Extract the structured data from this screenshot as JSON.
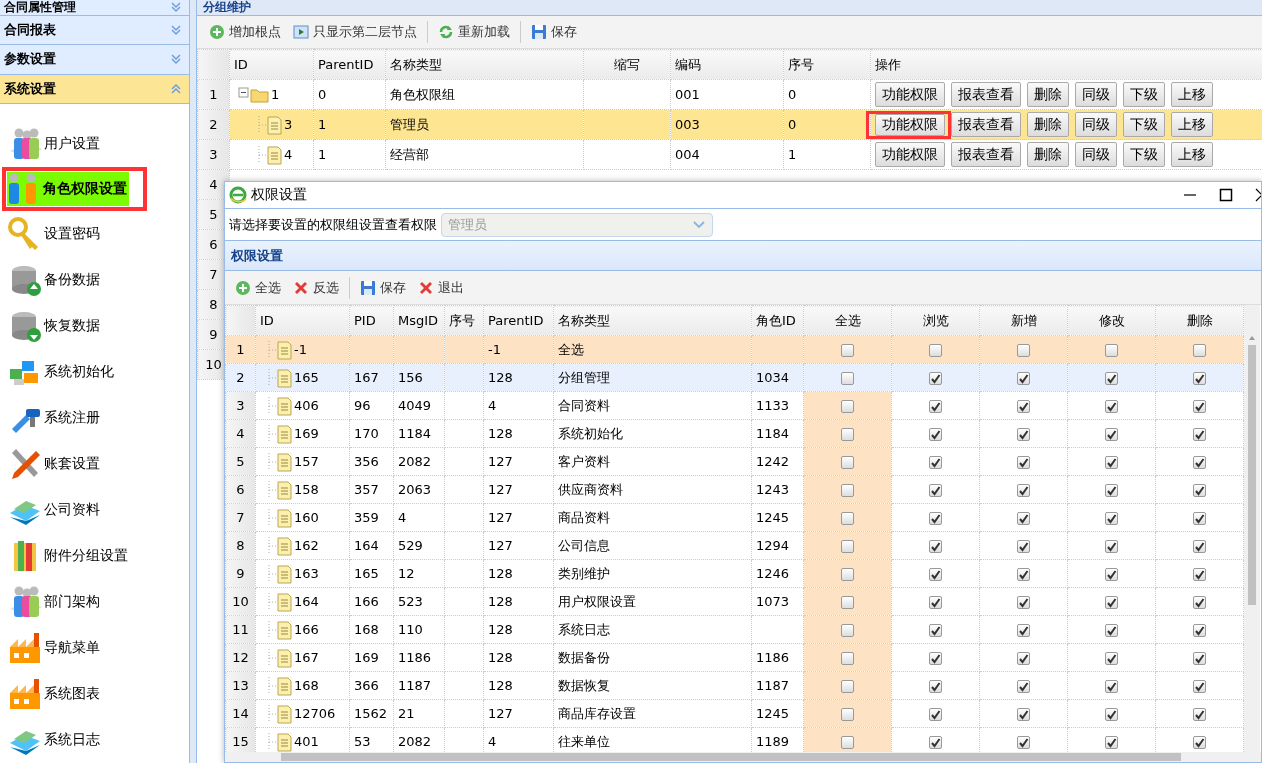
{
  "sidebar": {
    "sections": [
      {
        "title": "合同属性管理",
        "expanded": false
      },
      {
        "title": "合同报表",
        "expanded": false
      },
      {
        "title": "参数设置",
        "expanded": false
      },
      {
        "title": "系统设置",
        "expanded": true,
        "items": [
          {
            "label": "用户设置",
            "selected": false,
            "highlighted": false
          },
          {
            "label": "角色权限设置",
            "selected": true,
            "highlighted": true
          },
          {
            "label": "设置密码",
            "selected": false,
            "highlighted": false
          },
          {
            "label": "备份数据",
            "selected": false,
            "highlighted": false
          },
          {
            "label": "恢复数据",
            "selected": false,
            "highlighted": false
          },
          {
            "label": "系统初始化",
            "selected": false,
            "highlighted": false
          },
          {
            "label": "系统注册",
            "selected": false,
            "highlighted": false
          },
          {
            "label": "账套设置",
            "selected": false,
            "highlighted": false
          },
          {
            "label": "公司资料",
            "selected": false,
            "highlighted": false
          },
          {
            "label": "附件分组设置",
            "selected": false,
            "highlighted": false
          },
          {
            "label": "部门架构",
            "selected": false,
            "highlighted": false
          },
          {
            "label": "导航菜单",
            "selected": false,
            "highlighted": false
          },
          {
            "label": "系统图表",
            "selected": false,
            "highlighted": false
          },
          {
            "label": "系统日志",
            "selected": false,
            "highlighted": false
          }
        ]
      }
    ]
  },
  "main": {
    "panel_title": "分组维护",
    "toolbar": [
      {
        "label": "增加根点"
      },
      {
        "label": "只显示第二层节点"
      },
      {
        "label": "重新加载"
      },
      {
        "label": "保存"
      }
    ],
    "table": {
      "columns": [
        "ID",
        "ParentID",
        "名称类型",
        "缩写",
        "编码",
        "序号",
        "操作"
      ],
      "rows": [
        {
          "num": "1",
          "kind": "folder",
          "id": "1",
          "parent_id": "0",
          "name": "角色权限组",
          "code": "001",
          "seq": "0",
          "selected": false,
          "actions": [
            {
              "label": "功能权限",
              "highlighted": false
            },
            {
              "label": "报表查看",
              "highlighted": false
            },
            {
              "label": "删除",
              "highlighted": false
            },
            {
              "label": "同级",
              "highlighted": false
            },
            {
              "label": "下级",
              "highlighted": false
            },
            {
              "label": "上移",
              "highlighted": false
            }
          ]
        },
        {
          "num": "2",
          "kind": "file",
          "id": "3",
          "parent_id": "1",
          "name": "管理员",
          "code": "003",
          "seq": "0",
          "selected": true,
          "actions": [
            {
              "label": "功能权限",
              "highlighted": true
            },
            {
              "label": "报表查看",
              "highlighted": false
            },
            {
              "label": "删除",
              "highlighted": false
            },
            {
              "label": "同级",
              "highlighted": false
            },
            {
              "label": "下级",
              "highlighted": false
            },
            {
              "label": "上移",
              "highlighted": false
            }
          ]
        },
        {
          "num": "3",
          "kind": "file",
          "id": "4",
          "parent_id": "1",
          "name": "经营部",
          "code": "004",
          "seq": "1",
          "selected": false,
          "actions": [
            {
              "label": "功能权限",
              "highlighted": false
            },
            {
              "label": "报表查看",
              "highlighted": false
            },
            {
              "label": "删除",
              "highlighted": false
            },
            {
              "label": "同级",
              "highlighted": false
            },
            {
              "label": "下级",
              "highlighted": false
            },
            {
              "label": "上移",
              "highlighted": false
            }
          ]
        },
        {
          "num": "4"
        },
        {
          "num": "5"
        },
        {
          "num": "6"
        },
        {
          "num": "7"
        },
        {
          "num": "8"
        },
        {
          "num": "9"
        },
        {
          "num": "10"
        }
      ]
    }
  },
  "dialog": {
    "title": "权限设置",
    "prompt": "请选择要设置的权限组设置查看权限",
    "group_select": {
      "value": "管理员",
      "disabled": true
    },
    "panel_title": "权限设置",
    "toolbar": [
      {
        "label": "全选"
      },
      {
        "label": "反选"
      },
      {
        "label": "保存"
      },
      {
        "label": "退出"
      }
    ],
    "grid": {
      "columns": [
        "ID",
        "PID",
        "MsgID",
        "序号",
        "ParentID",
        "名称类型",
        "角色ID",
        "全选",
        "浏览",
        "新增",
        "修改",
        "删除"
      ],
      "rows": [
        {
          "num": "1",
          "kind": "summary",
          "selected": false,
          "id": "-1",
          "parent_id": "-1",
          "name": "全选",
          "checks": [
            false,
            false,
            false,
            false,
            false
          ]
        },
        {
          "num": "2",
          "kind": "item",
          "selected": true,
          "id": "165",
          "pid": "167",
          "msg_id": "156",
          "parent_id": "128",
          "name": "分组管理",
          "role_id": "1034",
          "checks": [
            false,
            true,
            true,
            true,
            true
          ]
        },
        {
          "num": "3",
          "kind": "item",
          "selected": false,
          "id": "406",
          "pid": "96",
          "msg_id": "4049",
          "parent_id": "4",
          "name": "合同资料",
          "role_id": "1133",
          "checks": [
            false,
            true,
            true,
            true,
            true
          ]
        },
        {
          "num": "4",
          "kind": "item",
          "selected": false,
          "id": "169",
          "pid": "170",
          "msg_id": "1184",
          "parent_id": "128",
          "name": "系统初始化",
          "role_id": "1184",
          "checks": [
            false,
            true,
            true,
            true,
            true
          ]
        },
        {
          "num": "5",
          "kind": "item",
          "selected": false,
          "id": "157",
          "pid": "356",
          "msg_id": "2082",
          "parent_id": "127",
          "name": "客户资料",
          "role_id": "1242",
          "checks": [
            false,
            true,
            true,
            true,
            true
          ]
        },
        {
          "num": "6",
          "kind": "item",
          "selected": false,
          "id": "158",
          "pid": "357",
          "msg_id": "2063",
          "parent_id": "127",
          "name": "供应商资料",
          "role_id": "1243",
          "checks": [
            false,
            true,
            true,
            true,
            true
          ]
        },
        {
          "num": "7",
          "kind": "item",
          "selected": false,
          "id": "160",
          "pid": "359",
          "msg_id": "4",
          "parent_id": "127",
          "name": "商品资料",
          "role_id": "1245",
          "checks": [
            false,
            true,
            true,
            true,
            true
          ]
        },
        {
          "num": "8",
          "kind": "item",
          "selected": false,
          "id": "162",
          "pid": "164",
          "msg_id": "529",
          "parent_id": "127",
          "name": "公司信息",
          "role_id": "1294",
          "checks": [
            false,
            true,
            true,
            true,
            true
          ]
        },
        {
          "num": "9",
          "kind": "item",
          "selected": false,
          "id": "163",
          "pid": "165",
          "msg_id": "12",
          "parent_id": "128",
          "name": "类别维护",
          "role_id": "1246",
          "checks": [
            false,
            true,
            true,
            true,
            true
          ]
        },
        {
          "num": "10",
          "kind": "item",
          "selected": false,
          "id": "164",
          "pid": "166",
          "msg_id": "523",
          "parent_id": "128",
          "name": "用户权限设置",
          "role_id": "1073",
          "checks": [
            false,
            true,
            true,
            true,
            true
          ]
        },
        {
          "num": "11",
          "kind": "item",
          "selected": false,
          "id": "166",
          "pid": "168",
          "msg_id": "110",
          "parent_id": "128",
          "name": "系统日志",
          "checks": [
            false,
            true,
            true,
            true,
            true
          ]
        },
        {
          "num": "12",
          "kind": "item",
          "selected": false,
          "id": "167",
          "pid": "169",
          "msg_id": "1186",
          "parent_id": "128",
          "name": "数据备份",
          "role_id": "1186",
          "checks": [
            false,
            true,
            true,
            true,
            true
          ]
        },
        {
          "num": "13",
          "kind": "item",
          "selected": false,
          "id": "168",
          "pid": "366",
          "msg_id": "1187",
          "parent_id": "128",
          "name": "数据恢复",
          "role_id": "1187",
          "checks": [
            false,
            true,
            true,
            true,
            true
          ]
        },
        {
          "num": "14",
          "kind": "item",
          "selected": false,
          "id": "12706",
          "pid": "1562",
          "msg_id": "21",
          "parent_id": "127",
          "name": "商品库存设置",
          "role_id": "1245",
          "checks": [
            false,
            true,
            true,
            true,
            true
          ]
        },
        {
          "num": "15",
          "kind": "item",
          "selected": false,
          "id": "401",
          "pid": "53",
          "msg_id": "2082",
          "parent_id": "4",
          "name": "往来单位",
          "role_id": "1189",
          "checks": [
            false,
            true,
            true,
            true,
            true
          ]
        }
      ]
    }
  }
}
